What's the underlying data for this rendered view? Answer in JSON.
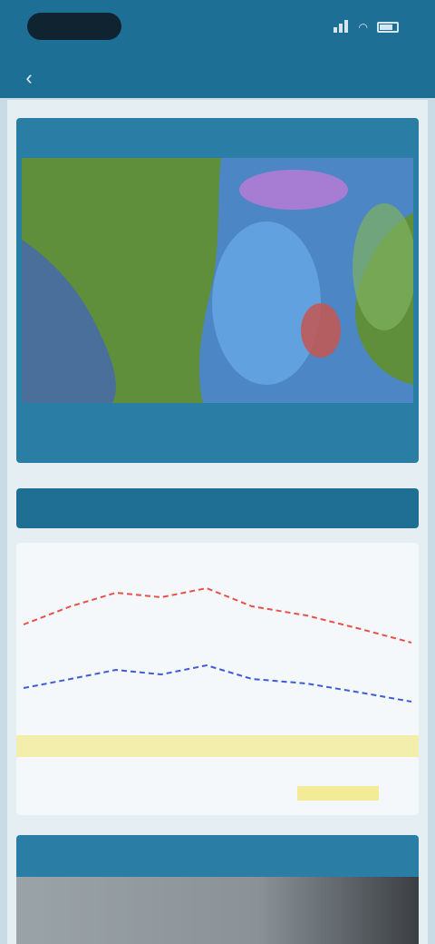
{
  "status": {
    "time": "",
    "battery": ""
  },
  "nav": {
    "back_label": "‹",
    "title": ""
  },
  "map_card": {
    "title": "",
    "caption": ""
  },
  "forecast_header": {
    "title": ""
  },
  "forecast_chart": {
    "series": [
      {
        "color": "#e8504a"
      },
      {
        "color": "#3e5bd8"
      }
    ]
  },
  "video_card": {
    "title": ""
  },
  "colors": {
    "accent": "#1e6f96",
    "card": "#2a7ea6",
    "background": "#c9dce6",
    "map_land": "#5f8f3a",
    "temp_red": "#e8504a",
    "temp_blue": "#3e5bd8",
    "highlight_yellow": "#f2e56a"
  }
}
